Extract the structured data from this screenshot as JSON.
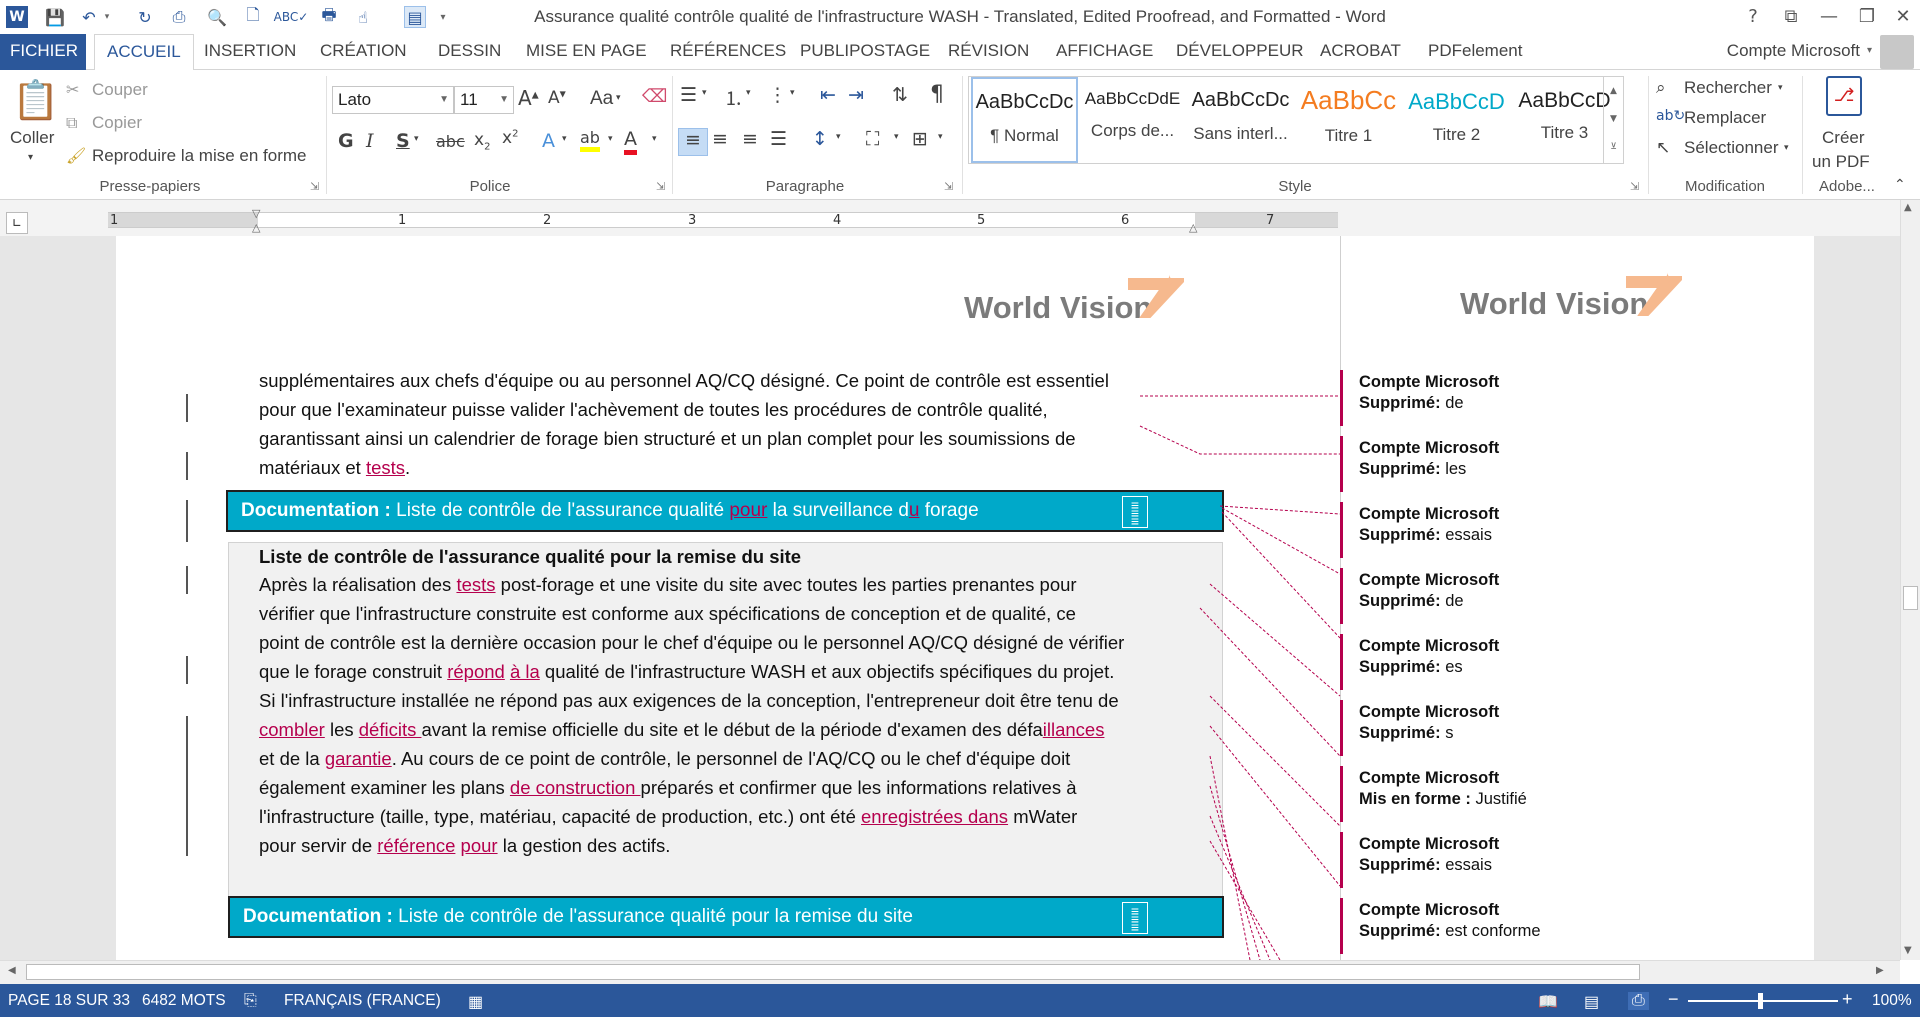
{
  "window": {
    "title": "Assurance qualité  contrôle qualité de l'infrastructure WASH - Translated, Edited Proofread, and Formatted - Word",
    "help": "?",
    "controls": [
      "restore-ribbon",
      "minimize",
      "maximize",
      "close"
    ]
  },
  "tabs": [
    "FICHIER",
    "ACCUEIL",
    "INSERTION",
    "CRÉATION",
    "DESSIN",
    "MISE EN PAGE",
    "RÉFÉRENCES",
    "PUBLIPOSTAGE",
    "RÉVISION",
    "AFFICHAGE",
    "DÉVELOPPEUR",
    "ACROBAT",
    "PDFelement"
  ],
  "active_tab": "ACCUEIL",
  "account": "Compte Microsoft",
  "ribbon": {
    "clipboard": {
      "paste": "Coller",
      "cut": "Couper",
      "copy": "Copier",
      "format_painter": "Reproduire la mise en forme",
      "label": "Presse-papiers"
    },
    "font": {
      "name": "Lato",
      "size": "11",
      "label": "Police",
      "case": "Aa"
    },
    "paragraph": {
      "label": "Paragraphe"
    },
    "styles": {
      "label": "Style",
      "items": [
        {
          "preview": "AaBbCcDc",
          "name": "¶ Normal",
          "color": "#222222"
        },
        {
          "preview": "AaBbCcDdE",
          "name": "Corps de...",
          "color": "#222222"
        },
        {
          "preview": "AaBbCcDc",
          "name": "Sans interl...",
          "color": "#222222"
        },
        {
          "preview": "AaBbCc",
          "name": "Titre 1",
          "color": "#f47c20"
        },
        {
          "preview": "AaBbCcD",
          "name": "Titre 2",
          "color": "#00a9c9"
        },
        {
          "preview": "AaBbCcD",
          "name": "Titre 3",
          "color": "#222222"
        }
      ]
    },
    "editing": {
      "find": "Rechercher",
      "replace": "Remplacer",
      "select": "Sélectionner",
      "label": "Modification"
    },
    "adobe": {
      "create_line1": "Créer",
      "create_line2": "un PDF",
      "label": "Adobe..."
    }
  },
  "ruler": {
    "numbers": [
      "1",
      "1",
      "2",
      "3",
      "4",
      "5",
      "6",
      "7"
    ]
  },
  "document": {
    "logo": "World Vision",
    "para1": {
      "l1": "supplémentaires aux chefs d'équipe ou au personnel AQ/CQ désigné. Ce point de contrôle est essentiel",
      "l2": "pour que l'examinateur puisse valider l'achèvement de toutes les procédures de contrôle qualité,",
      "l3": "garantissant ainsi un calendrier de forage bien structuré et un plan complet pour les soumissions de",
      "l4a": "matériaux et ",
      "l4b": "tests",
      "l4c": "."
    },
    "docbar1": {
      "bold": "Documentation :",
      "a": " Liste de contrôle de l'assurance qualité ",
      "b": "pour",
      "c": " la surveillance d",
      "d": "u",
      "e": " forage"
    },
    "heading2": "Liste de contrôle de l'assurance qualité pour la remise du site",
    "para2": {
      "l1a": "Après la réalisation des ",
      "l1b": "tests",
      "l1c": " post-forage et une visite du site avec toutes les parties prenantes pour",
      "l2": "vérifier que l'infrastructure construite est conforme aux spécifications de conception et de qualité, ce",
      "l3": "point de contrôle est la dernière occasion pour le chef d'équipe ou le personnel AQ/CQ désigné de vérifier",
      "l4a": "que le forage construit ",
      "l4b": "répond",
      "l4c": " ",
      "l4d": "à la",
      "l4e": " qualité de l'infrastructure WASH et aux objectifs spécifiques du projet.",
      "l5": "Si l'infrastructure installée ne répond pas aux exigences de la conception, l'entrepreneur doit être tenu de",
      "l6a": "combler",
      "l6b": " les ",
      "l6c": "déficits ",
      "l6d": "avant la remise officielle du site et le début de la période d'examen des défa",
      "l6e": "illances",
      "l7a": "et de la ",
      "l7b": "garantie",
      "l7c": ". Au cours de ce point de contrôle, le personnel de l'AQ/CQ ou le chef d'équipe doit",
      "l8a": "également examiner les plans ",
      "l8b": "de construction ",
      "l8c": "préparés et confirmer que les informations relatives à",
      "l9a": "l'infrastructure (taille, type, matériau, capacité de production, etc.) ont été ",
      "l9b": "enregistrées dans",
      "l9c": " mWater",
      "l10a": "pour servir de ",
      "l10b": "référence",
      "l10c": " ",
      "l10d": "pour",
      "l10e": " la gestion des actifs."
    },
    "docbar2": {
      "bold": "Documentation :",
      "a": " Liste de contrôle de l'assurance qualité pour la remise du site"
    }
  },
  "comments": [
    {
      "author": "Compte Microsoft",
      "action": "Supprimé:",
      "value": "de"
    },
    {
      "author": "Compte Microsoft",
      "action": "Supprimé:",
      "value": "les"
    },
    {
      "author": "Compte Microsoft",
      "action": "Supprimé:",
      "value": "essais"
    },
    {
      "author": "Compte Microsoft",
      "action": "Supprimé:",
      "value": "de"
    },
    {
      "author": "Compte Microsoft",
      "action": "Supprimé:",
      "value": "es"
    },
    {
      "author": "Compte Microsoft",
      "action": "Supprimé:",
      "value": "s"
    },
    {
      "author": "Compte Microsoft",
      "action": "Mis en forme :",
      "value": "Justifié"
    },
    {
      "author": "Compte Microsoft",
      "action": "Supprimé:",
      "value": "essais"
    },
    {
      "author": "Compte Microsoft",
      "action": "Supprimé:",
      "value": "est conforme"
    }
  ],
  "status": {
    "page": "PAGE 18 SUR 33",
    "words": "6482 MOTS",
    "language": "FRANÇAIS (FRANCE)",
    "zoom": "100%"
  },
  "colors": {
    "word_blue": "#2b579a",
    "teal": "#00a9c9",
    "track_red": "#b5004d"
  }
}
